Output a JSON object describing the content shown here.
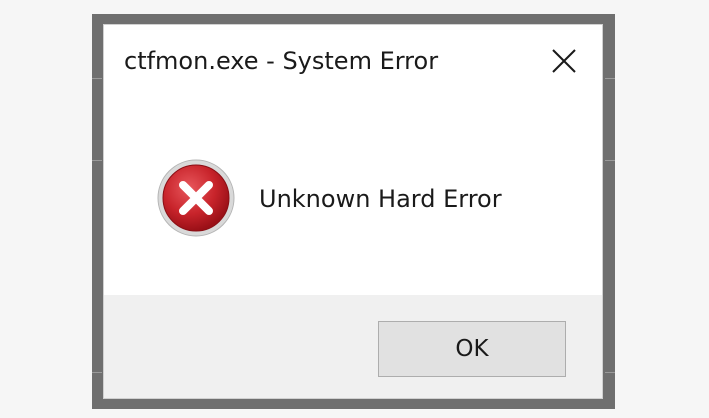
{
  "dialog": {
    "title": "ctfmon.exe - System Error",
    "message": "Unknown Hard Error",
    "ok_label": "OK",
    "icon": "error-icon",
    "close_icon": "close-icon"
  },
  "colors": {
    "error_red": "#c8242b",
    "footer_bg": "#f0f0f0",
    "button_bg": "#e1e1e1"
  }
}
